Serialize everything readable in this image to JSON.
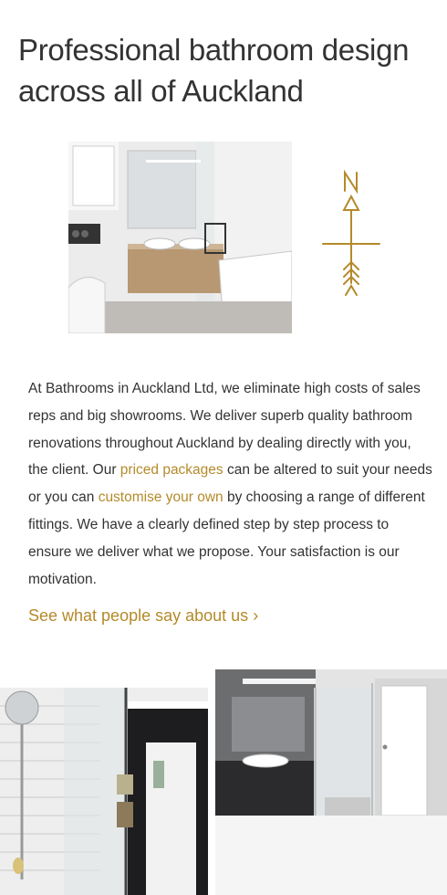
{
  "hero": {
    "title": "Professional bathroom design across all of Auckland"
  },
  "compass": {
    "letter": "N",
    "icon": "compass-arrow-icon"
  },
  "intro": {
    "part1": "At Bathrooms in Auckland Ltd, we eliminate high costs of sales reps and big showrooms. We deliver superb quality bathroom renovations throughout Auckland by dealing directly with you, the client. Our ",
    "link1": "priced packages",
    "part2": " can be altered to suit your needs or you can ",
    "link2": "customise your own",
    "part3": " by choosing a range of different fittings. We have a clearly defined step by step process to ensure we deliver what we propose. Your satisfaction is our motivation."
  },
  "testimonials_link": {
    "label": "See what people say about us",
    "chevron": "›"
  },
  "colors": {
    "accent": "#b48a2a",
    "text": "#333333"
  }
}
